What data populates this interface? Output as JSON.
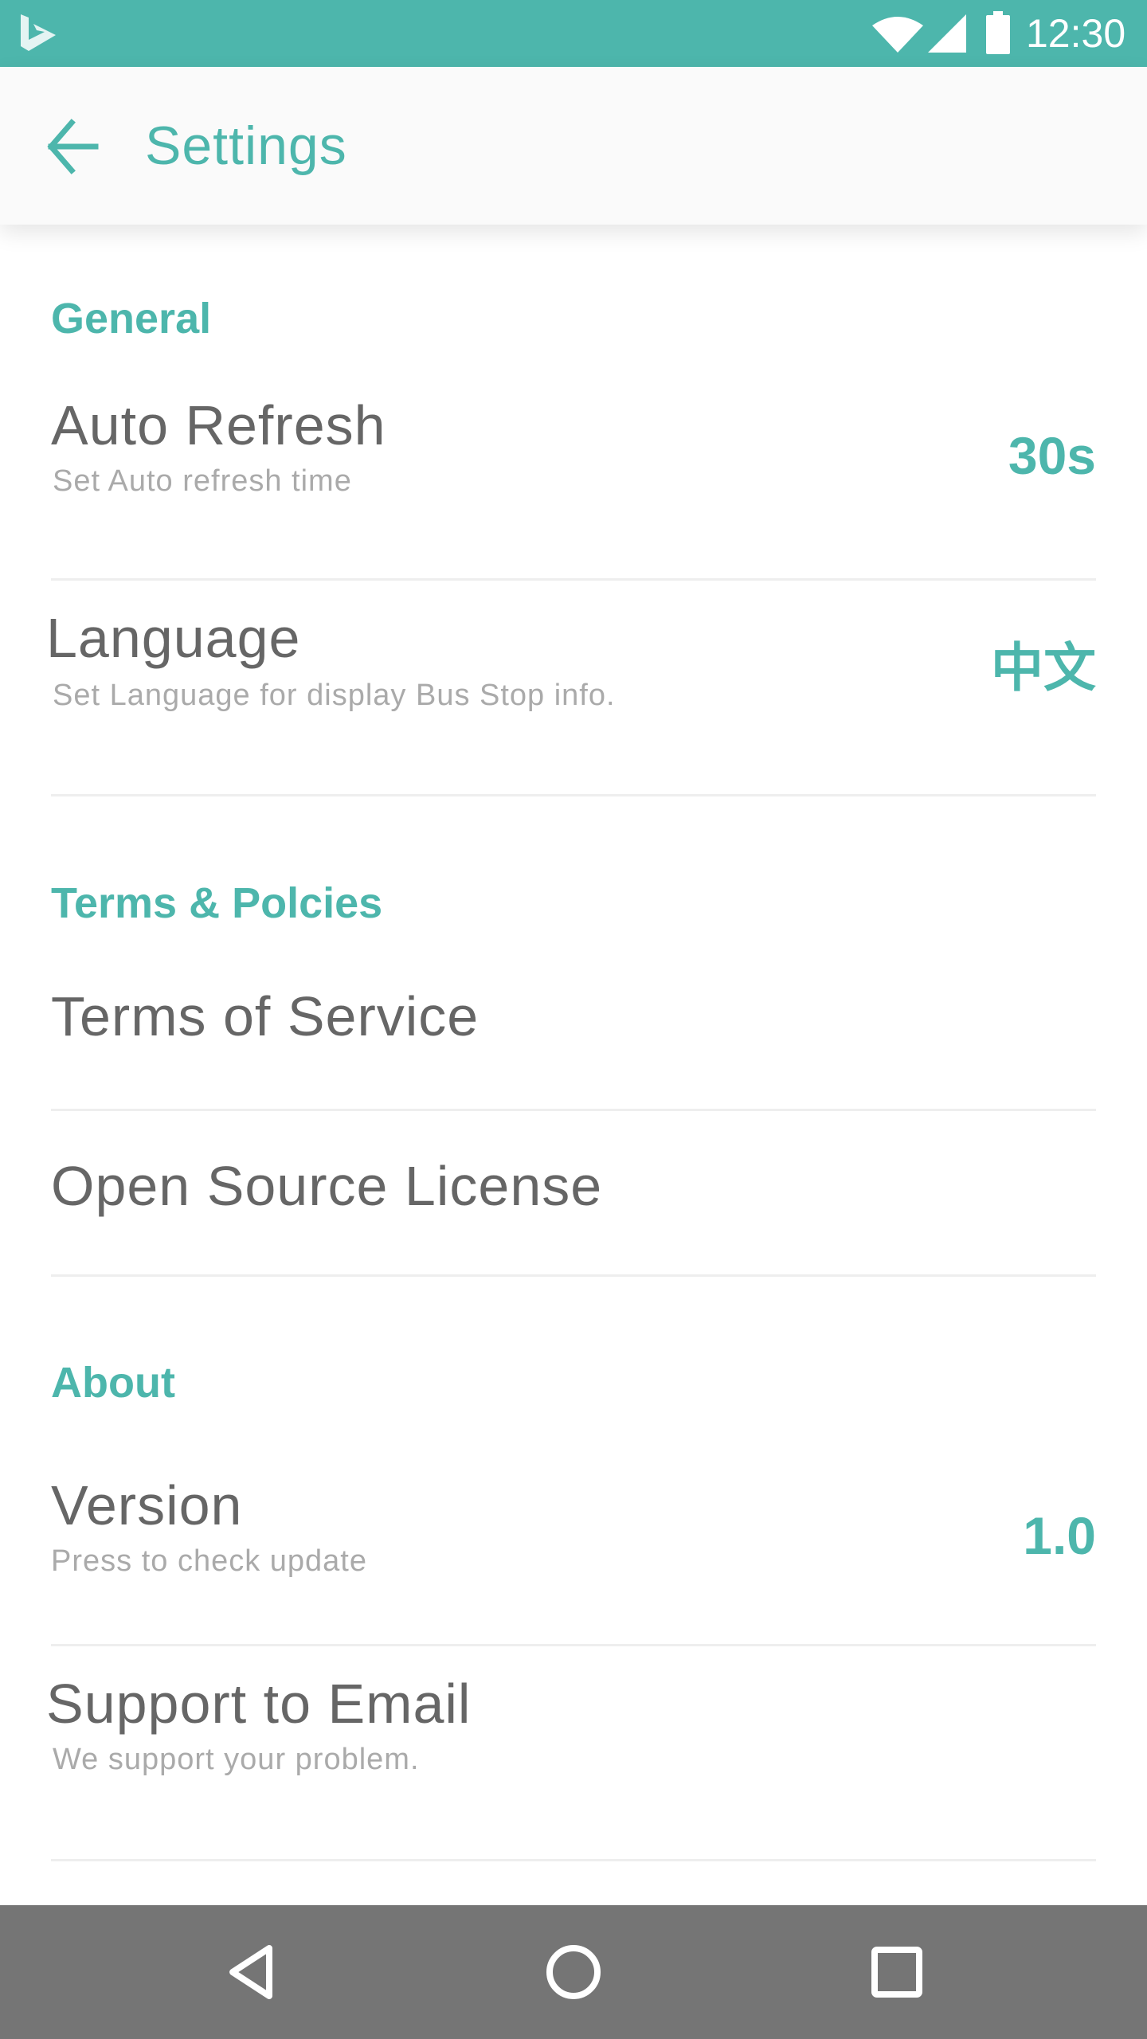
{
  "status_bar": {
    "time": "12:30",
    "icons": [
      "bing-logo-icon",
      "wifi-icon",
      "cell-signal-icon",
      "battery-icon"
    ],
    "background_color": "#4db6ac"
  },
  "app_bar": {
    "title": "Settings",
    "back_icon": "arrow-back-icon",
    "accent_color": "#4db6ac"
  },
  "sections": {
    "general": {
      "header": "General",
      "auto_refresh": {
        "title": "Auto Refresh",
        "subtitle": "Set Auto refresh time",
        "value": "30s"
      },
      "language": {
        "title": "Language",
        "subtitle": "Set Language for display Bus Stop info.",
        "value": "中文"
      }
    },
    "terms": {
      "header": "Terms & Polcies",
      "terms_of_service": {
        "title": "Terms of Service"
      },
      "open_source_license": {
        "title": "Open Source License"
      }
    },
    "about": {
      "header": "About",
      "version": {
        "title": "Version",
        "subtitle": "Press to check update",
        "value": "1.0"
      },
      "support": {
        "title": "Support to Email",
        "subtitle": "We support your problem."
      }
    }
  },
  "nav_bar": {
    "buttons": [
      "back-triangle-icon",
      "home-circle-icon",
      "recents-square-icon"
    ],
    "background_color": "#757575"
  }
}
